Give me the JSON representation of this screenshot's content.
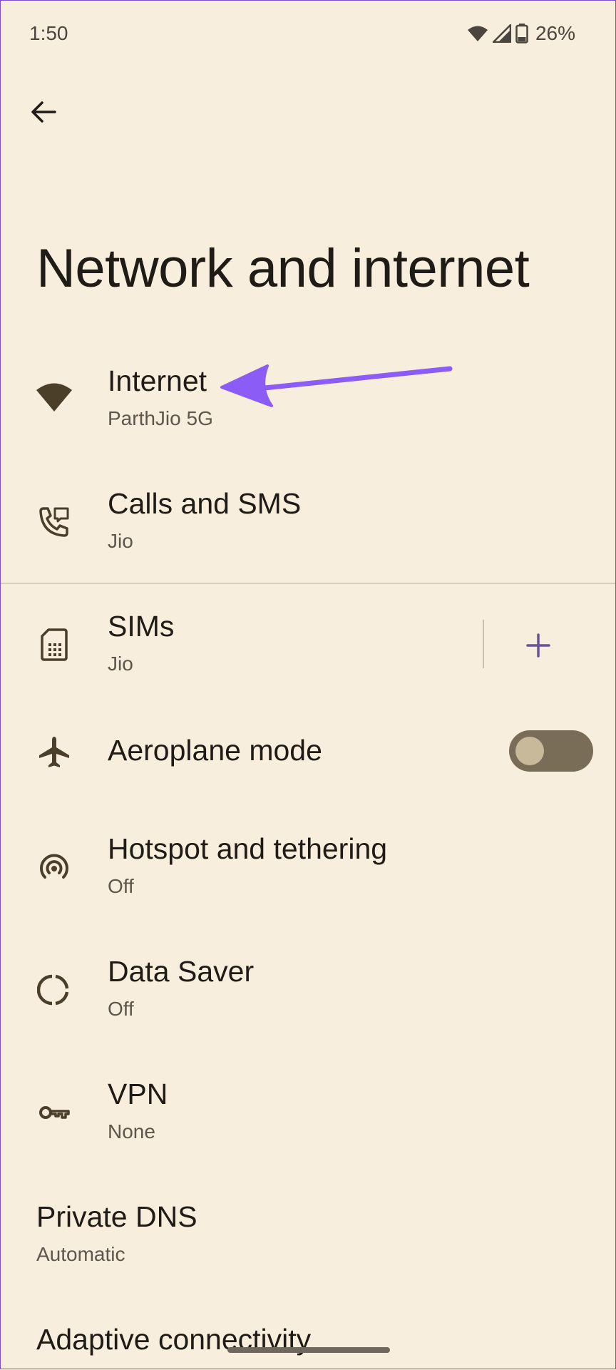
{
  "status_bar": {
    "time": "1:50",
    "battery_percent": "26%",
    "icons": [
      "wifi-icon",
      "cellular-signal-icon",
      "battery-icon"
    ]
  },
  "header": {
    "back_icon": "arrow-left-icon",
    "title": "Network and internet"
  },
  "items": [
    {
      "icon": "wifi-icon",
      "title": "Internet",
      "subtitle": "ParthJio 5G"
    },
    {
      "icon": "calls-sms-icon",
      "title": "Calls and SMS",
      "subtitle": "Jio"
    },
    {
      "icon": "sim-card-icon",
      "title": "SIMs",
      "subtitle": "Jio",
      "action_icon": "plus-icon"
    },
    {
      "icon": "airplane-icon",
      "title": "Aeroplane mode",
      "toggle_on": false
    },
    {
      "icon": "hotspot-icon",
      "title": "Hotspot and tethering",
      "subtitle": "Off"
    },
    {
      "icon": "data-saver-icon",
      "title": "Data Saver",
      "subtitle": "Off"
    },
    {
      "icon": "vpn-key-icon",
      "title": "VPN",
      "subtitle": "None"
    },
    {
      "title": "Private DNS",
      "subtitle": "Automatic"
    },
    {
      "title": "Adaptive connectivity"
    }
  ],
  "colors": {
    "background": "#f8eedd",
    "text_primary": "#1f1b16",
    "text_secondary": "#5c564d",
    "icon": "#4b3f2a",
    "accent_plus": "#6b4fa0",
    "toggle_track": "#7a6d58",
    "annotation_arrow": "#8b5cf6"
  }
}
